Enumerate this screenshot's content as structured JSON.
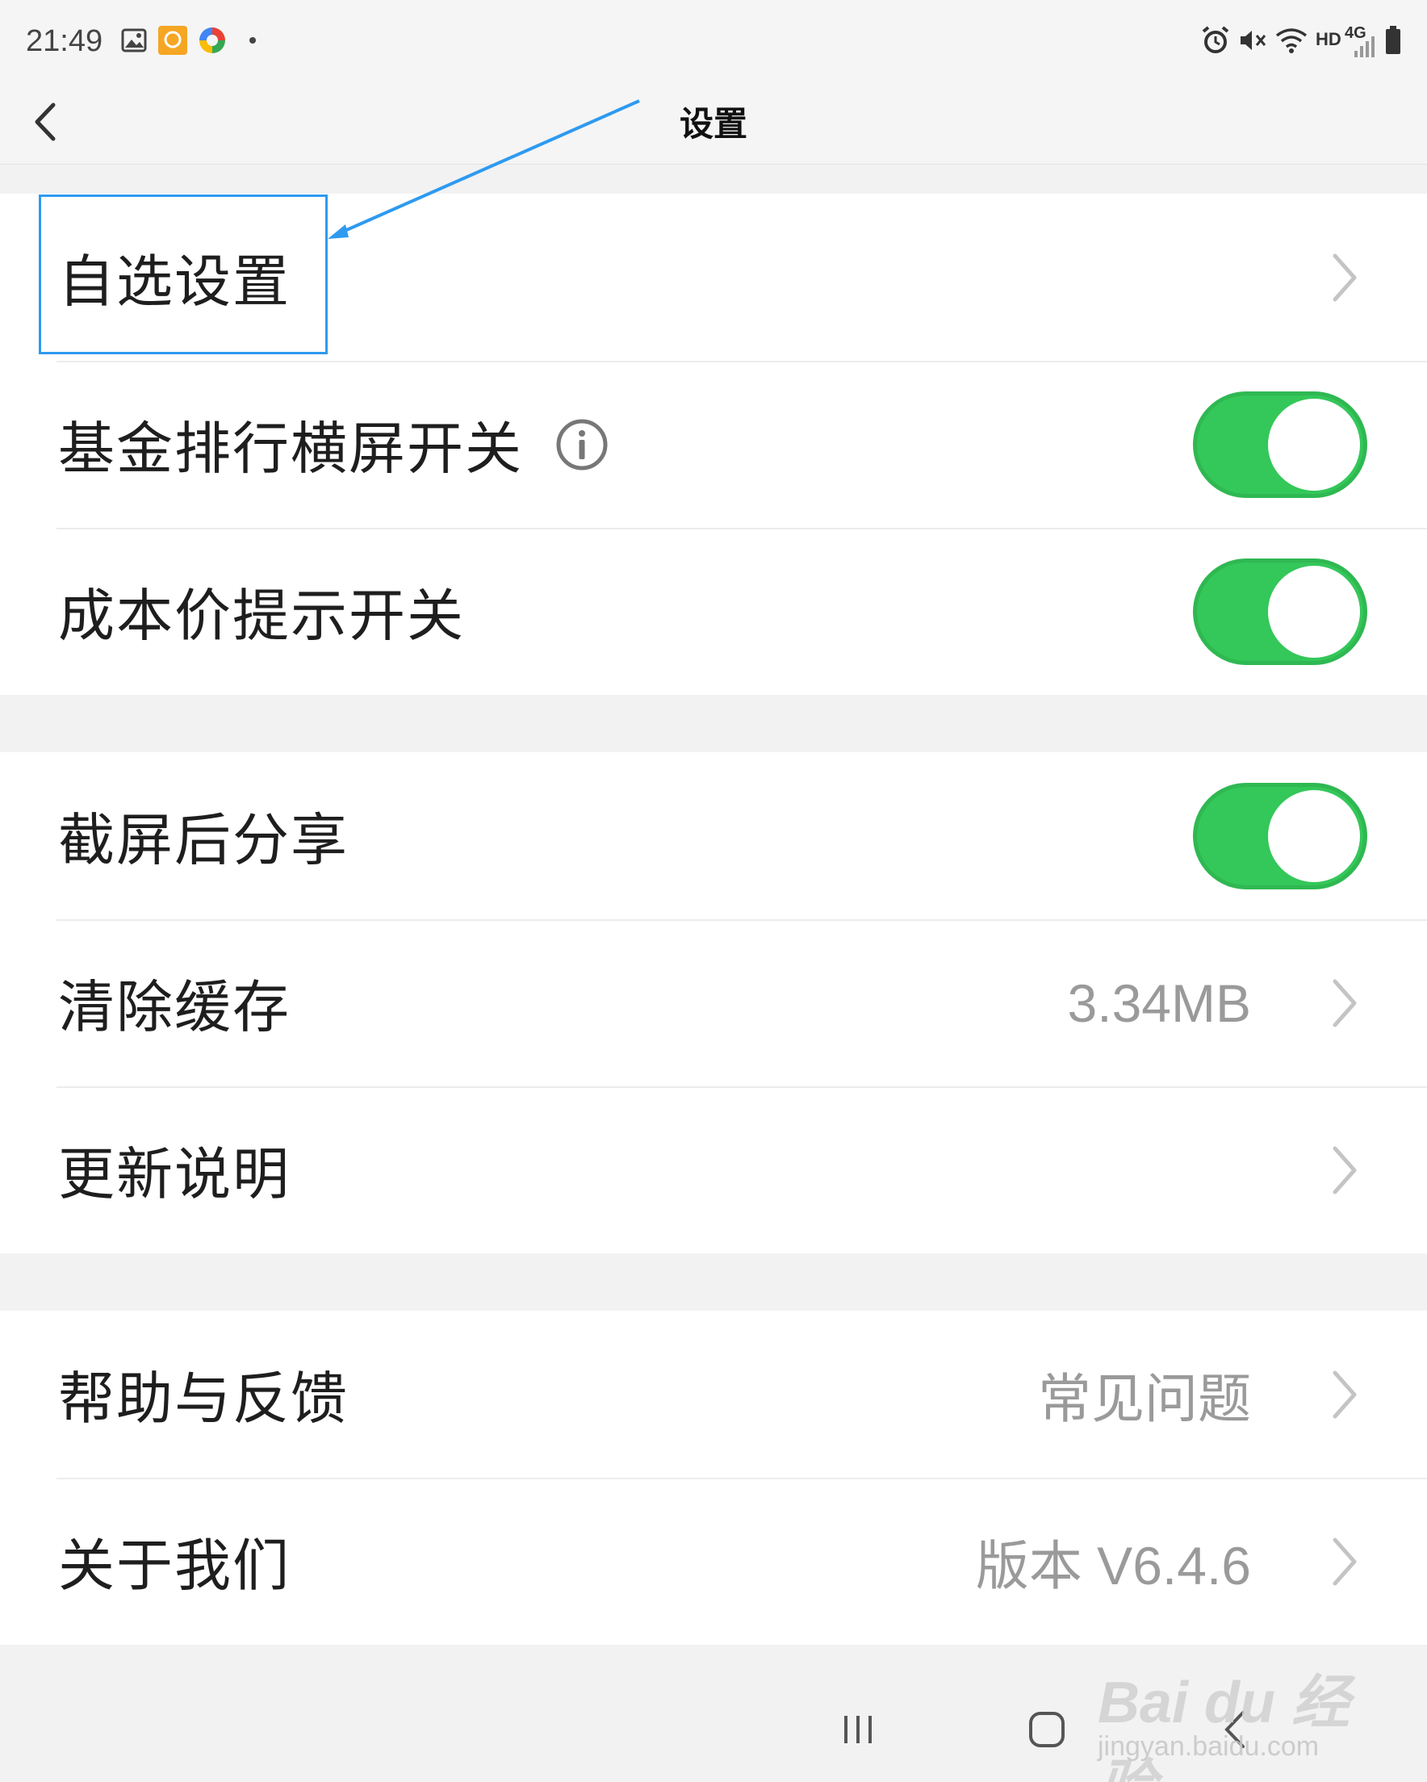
{
  "status_bar": {
    "time": "21:49",
    "left_icons": [
      "image-icon",
      "app-badge-icon",
      "colorful-app-icon",
      "dot-icon"
    ],
    "right_icons": [
      "alarm-icon",
      "mute-icon",
      "wifi-icon",
      "signal-icon",
      "battery-icon"
    ],
    "hd_label": "HD",
    "network_label": "4G"
  },
  "nav": {
    "title": "设置",
    "back_icon": "back-chevron-icon"
  },
  "groups": [
    {
      "rows": [
        {
          "label": "自选设置",
          "type": "link"
        },
        {
          "label": "基金排行横屏开关",
          "type": "toggle",
          "on": true,
          "info_icon": "info-icon"
        },
        {
          "label": "成本价提示开关",
          "type": "toggle",
          "on": true
        }
      ]
    },
    {
      "rows": [
        {
          "label": "截屏后分享",
          "type": "toggle",
          "on": true
        },
        {
          "label": "清除缓存",
          "type": "link",
          "value": "3.34MB"
        },
        {
          "label": "更新说明",
          "type": "link"
        }
      ]
    },
    {
      "rows": [
        {
          "label": "帮助与反馈",
          "type": "link",
          "value": "常见问题"
        },
        {
          "label": "关于我们",
          "type": "link",
          "value": "版本 V6.4.6"
        }
      ]
    }
  ],
  "system_nav": {
    "icons": [
      "recents-icon",
      "home-icon",
      "back-icon"
    ]
  },
  "watermark": {
    "logo": "Bai du 经验",
    "url": "jingyan.baidu.com"
  },
  "colors": {
    "toggle_on": "#34c759",
    "highlight": "#2e9af0",
    "value_text": "#9a9a9a"
  }
}
